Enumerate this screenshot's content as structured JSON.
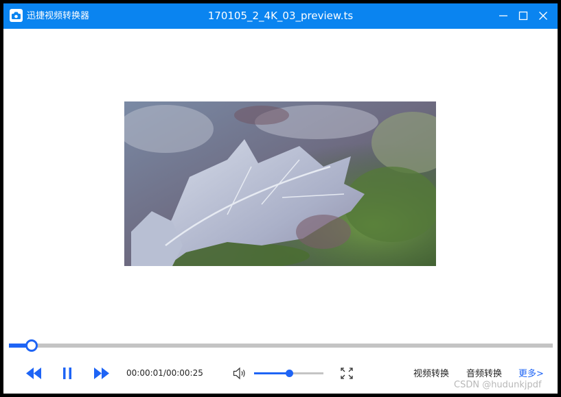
{
  "window": {
    "app_name": "迅捷视频转换器",
    "file_title": "170105_2_4K_03_preview.ts"
  },
  "colors": {
    "titlebar": "#0a84f0",
    "accent": "#1e64f5",
    "track": "#c4c4c4",
    "text": "#222222"
  },
  "icons": {
    "app_logo": "camera-logo-icon",
    "minimize": "minimize-icon",
    "maximize": "maximize-icon",
    "close": "close-icon",
    "rewind": "rewind-icon",
    "pause": "pause-icon",
    "forward": "fast-forward-icon",
    "volume": "speaker-icon",
    "fullscreen": "fullscreen-icon"
  },
  "player": {
    "elapsed": "00:00:01",
    "duration": "00:00:25",
    "time_text": "00:00:01/00:00:25",
    "progress_fraction": 0.04,
    "volume_fraction": 0.5
  },
  "actions": {
    "video_convert": "视频转换",
    "audio_convert": "音频转换",
    "more": "更多>"
  },
  "watermark": "CSDN @hudunkjpdf"
}
